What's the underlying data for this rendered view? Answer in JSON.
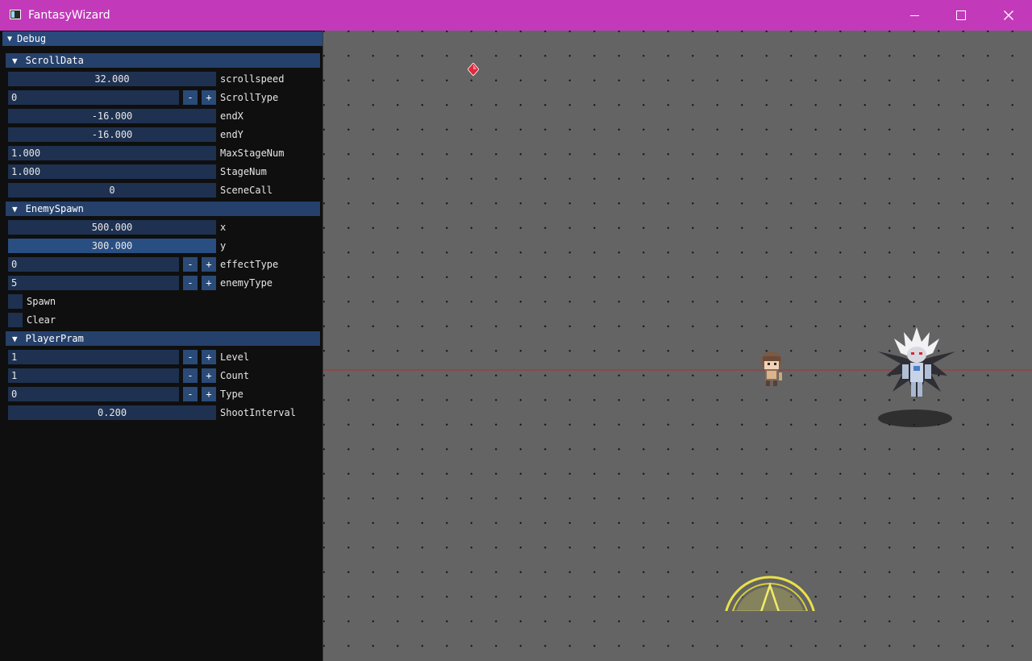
{
  "window": {
    "title": "FantasyWizard",
    "icons": {
      "app": "app-window-icon",
      "minimize": "minimize-icon",
      "maximize": "maximize-icon",
      "close": "close-icon"
    }
  },
  "debug": {
    "title": "Debug",
    "scroll_data": {
      "header": "ScrollData",
      "scrollspeed": {
        "value": "32.000",
        "label": "scrollspeed"
      },
      "scroll_type": {
        "value": "0",
        "label": "ScrollType"
      },
      "end_x": {
        "value": "-16.000",
        "label": "endX"
      },
      "end_y": {
        "value": "-16.000",
        "label": "endY"
      },
      "max_stage_num": {
        "value": "1.000",
        "label": "MaxStageNum"
      },
      "stage_num": {
        "value": "1.000",
        "label": "StageNum"
      },
      "scene_call": {
        "value": "0",
        "label": "SceneCall"
      }
    },
    "enemy_spawn": {
      "header": "EnemySpawn",
      "x": {
        "value": "500.000",
        "label": "x"
      },
      "y": {
        "value": "300.000",
        "label": "y"
      },
      "effect_type": {
        "value": "0",
        "label": "effectType"
      },
      "enemy_type": {
        "value": "5",
        "label": "enemyType"
      },
      "spawn": {
        "label": "Spawn",
        "checked": false
      },
      "clear": {
        "label": "Clear",
        "checked": false
      }
    },
    "player_pram": {
      "header": "PlayerPram",
      "level": {
        "value": "1",
        "label": "Level"
      },
      "count": {
        "value": "1",
        "label": "Count"
      },
      "type": {
        "value": "0",
        "label": "Type"
      },
      "shoot_interval": {
        "value": "0.200",
        "label": "ShootInterval"
      }
    },
    "buttons": {
      "minus": "-",
      "plus": "+"
    },
    "collapse_arrow": "▼"
  },
  "colors": {
    "titlebar": "#c23aba",
    "panel_bg": "#0f0f0f",
    "header_bg": "#25406a",
    "field_bg": "#1e3150",
    "game_bg": "#646464",
    "scroll_line": "#8a4a4a"
  }
}
